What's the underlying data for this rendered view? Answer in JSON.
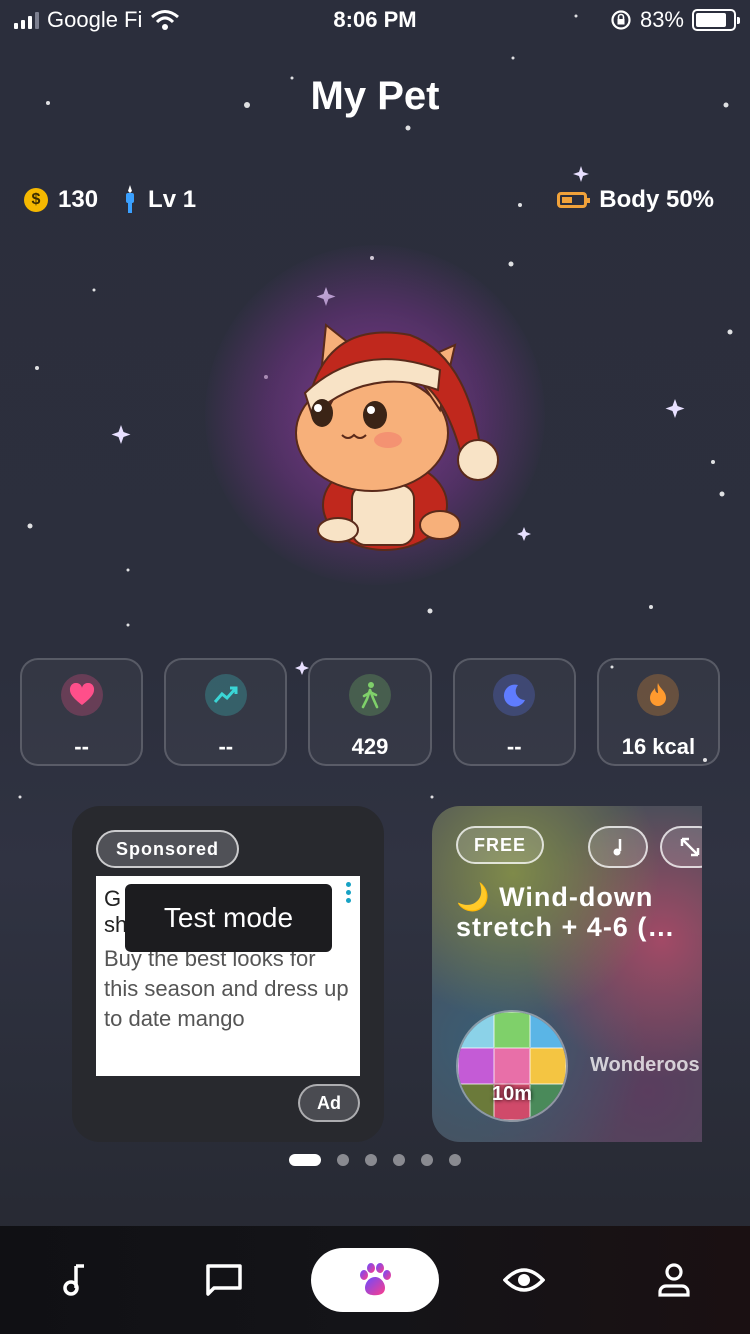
{
  "status_bar": {
    "carrier": "Google Fi",
    "time": "8:06 PM",
    "battery": "83%",
    "battery_level": 0.83
  },
  "header": {
    "title": "My Pet"
  },
  "stats": {
    "coins": "130",
    "level": "Lv 1",
    "body": "Body 50%",
    "body_level": 0.5
  },
  "metrics": [
    {
      "icon": "heart-icon",
      "value": "--",
      "color": "#ff4f8a"
    },
    {
      "icon": "trend-icon",
      "value": "--",
      "color": "#3ad6d6"
    },
    {
      "icon": "walk-icon",
      "value": "429",
      "color": "#7fd06a"
    },
    {
      "icon": "moon-icon",
      "value": "--",
      "color": "#5f7cff"
    },
    {
      "icon": "flame-icon",
      "value": "16 kcal",
      "color": "#ff9a2e"
    }
  ],
  "ad_card": {
    "badge": "Sponsored",
    "headline": "G",
    "headline_line2": "sh",
    "body": "Buy the best looks for this season and dress up to date mango",
    "tooltip": "Test mode",
    "ad_label": "Ad"
  },
  "media_card": {
    "badge": "FREE",
    "title": "🌙 Wind-down stretch + 4-6 (…",
    "duration": "10m",
    "channel": "Wonderoos"
  },
  "pager": {
    "count": 6,
    "active": 0
  },
  "nav": [
    {
      "icon": "music-note-icon"
    },
    {
      "icon": "chat-icon"
    },
    {
      "icon": "paw-icon"
    },
    {
      "icon": "eye-icon"
    },
    {
      "icon": "profile-icon"
    }
  ]
}
